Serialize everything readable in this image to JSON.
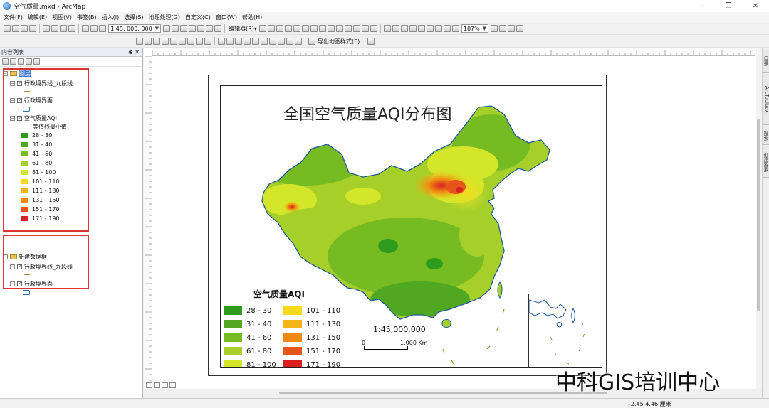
{
  "window": {
    "title": "空气质量.mxd - ArcMap"
  },
  "menu": [
    "文件(F)",
    "编辑(E)",
    "视图(V)",
    "书签(B)",
    "插入(I)",
    "选择(S)",
    "地理处理(G)",
    "自定义(C)",
    "窗口(W)",
    "帮助(H)"
  ],
  "toolbar": {
    "scale_value": "1:45, 000, 000",
    "editor_label": "编辑器(R)▾",
    "zoom_value": "107%",
    "export_label": "导出地图样式(E)..."
  },
  "toc": {
    "title": "内容列表",
    "frame1": {
      "name": "图层",
      "layers": [
        "行政境界线_九段线",
        "行政境界面",
        "空气质量AQI"
      ],
      "aqi_field": "等值线最小值",
      "classes": [
        "28 - 30",
        "31 - 40",
        "41 - 60",
        "61 - 80",
        "81 - 100",
        "101 - 110",
        "111 - 130",
        "131 - 150",
        "151 - 170",
        "171 - 190"
      ],
      "colors": [
        "#2e9a1e",
        "#4fa81f",
        "#77bb22",
        "#a6cf2a",
        "#d4e629",
        "#f7da1f",
        "#f3b417",
        "#ee8a12",
        "#e6541a",
        "#d91f1f"
      ]
    },
    "frame2": {
      "name": "新建数据框",
      "layers": [
        "行政境界线_九段线",
        "行政境界面"
      ]
    }
  },
  "map": {
    "title": "全国空气质量AQI分布图",
    "legend_title": "空气质量AQI",
    "legend_left": [
      "28  -  30",
      "31  -  40",
      "41  -  60",
      "61  -  80",
      "81  -  100"
    ],
    "legend_right": [
      "101  -  110",
      "111  -  130",
      "131  -  150",
      "151  -  170",
      "171  -  190"
    ],
    "scale_text": "1:45,000,000",
    "scale_zero": "0",
    "scale_km": "1,000 Km"
  },
  "right_tabs": [
    "目录",
    "ArcToolbox",
    "搜索",
    "创建要素"
  ],
  "status": {
    "coords": "-2.45  4.46 厘米"
  },
  "watermark": "中科GIS培训中心"
}
